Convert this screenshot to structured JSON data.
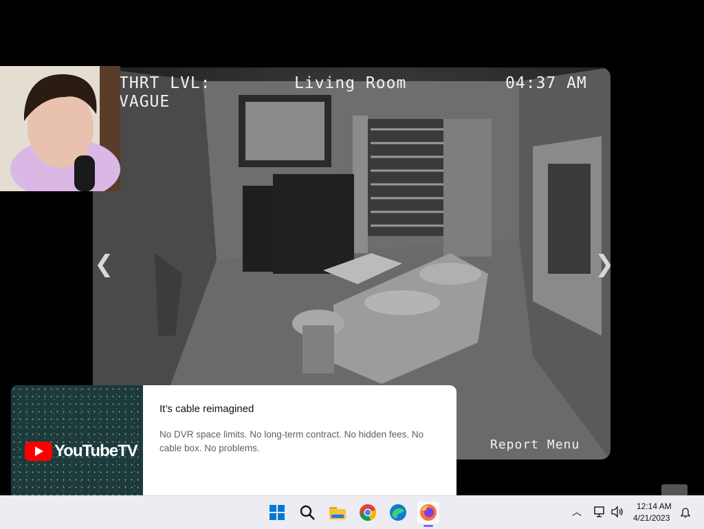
{
  "camera": {
    "threat_label": "THRT LVL:",
    "threat_value": "VAGUE",
    "room": "Living Room",
    "time": "04:37 AM",
    "report_menu": "Report Menu",
    "prev_icon": "chevron-left",
    "next_icon": "chevron-right"
  },
  "ad": {
    "brand": "YouTubeTV",
    "title": "It’s cable reimagined",
    "body": "No DVR space limits. No long-term contract. No hidden fees. No cable box. No problems."
  },
  "taskbar": {
    "icons": [
      "windows-start",
      "search",
      "file-explorer",
      "chrome",
      "edge",
      "firefox"
    ],
    "clock_time": "12:14 AM",
    "clock_date": "4/21/2023"
  },
  "colors": {
    "youtube_red": "#ff0000",
    "taskbar_bg": "#ececf2",
    "active_indicator": "#7b61ff"
  }
}
